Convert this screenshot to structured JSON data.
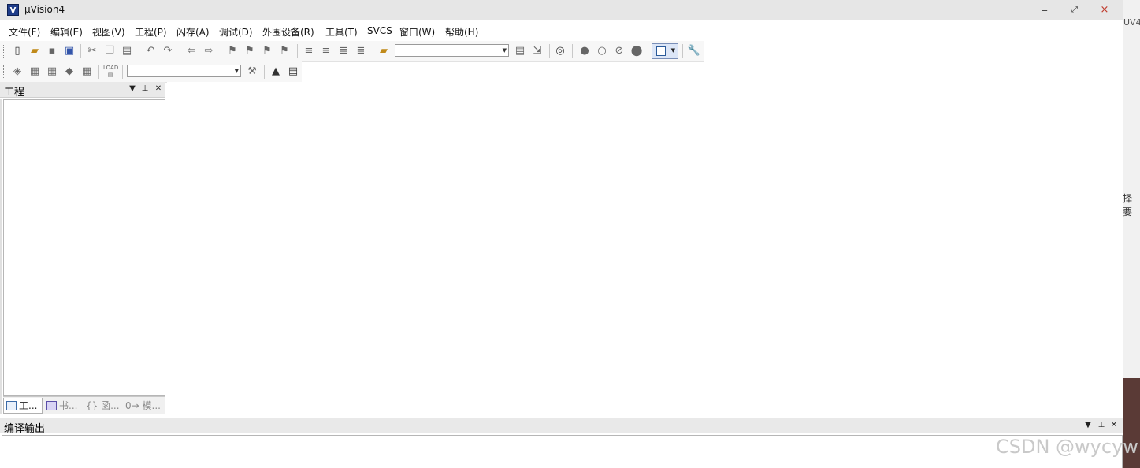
{
  "window": {
    "title": "µVision4",
    "logo_text": "V",
    "controls": {
      "minimize": "‒",
      "restore": "⤢",
      "close": "×"
    }
  },
  "menu": [
    {
      "label": "文件(F)"
    },
    {
      "label": "编辑(E)"
    },
    {
      "label": "视图(V)"
    },
    {
      "label": "工程(P)"
    },
    {
      "label": "闪存(A)"
    },
    {
      "label": "调试(D)"
    },
    {
      "label": "外围设备(R)"
    },
    {
      "label": "工具(T)"
    },
    {
      "label": "SVCS"
    },
    {
      "label": "窗口(W)"
    },
    {
      "label": "帮助(H)"
    }
  ],
  "toolbar1": {
    "find_combo_value": "",
    "icons": [
      "new-file-icon",
      "open-folder-icon",
      "save-icon",
      "save-all-icon",
      "cut-icon",
      "copy-icon",
      "paste-icon",
      "undo-icon",
      "redo-icon",
      "nav-back-icon",
      "nav-forward-icon",
      "bookmark-icon",
      "bookmark-prev-icon",
      "bookmark-next-icon",
      "bookmark-clear-icon",
      "indent-icon",
      "unindent-icon",
      "comment-icon",
      "uncomment-icon",
      "find-in-files-icon",
      "find-icon",
      "incremental-find-icon",
      "debug-start-icon",
      "breakpoint-icon",
      "breakpoint-disable-icon",
      "breakpoint-disable-all-icon",
      "breakpoint-kill-all-icon",
      "window-config-icon",
      "wrench-icon"
    ]
  },
  "toolbar2": {
    "target_combo_value": "",
    "load_label": "LOAD",
    "icons": [
      "translate-icon",
      "build-icon",
      "rebuild-icon",
      "batch-build-icon",
      "stop-build-icon",
      "download-icon",
      "target-options-icon",
      "manage-components-icon",
      "manage-books-icon"
    ]
  },
  "project_panel": {
    "title": "工程",
    "controls": {
      "dropdown": "▼",
      "pin": "⊥",
      "close": "✕"
    },
    "tabs": [
      {
        "label": "工...",
        "active": true
      },
      {
        "label": "书...",
        "active": false
      },
      {
        "label": "{} 函...",
        "active": false
      },
      {
        "label": "0→ 模...",
        "active": false
      }
    ]
  },
  "build_output": {
    "title": "编译输出",
    "controls": {
      "dropdown": "▼",
      "pin": "⊥",
      "close": "✕"
    }
  },
  "background": {
    "right_strip_top": "UV4",
    "right_strip_mid": "择要",
    "watermark": "CSDN @wycyw"
  }
}
